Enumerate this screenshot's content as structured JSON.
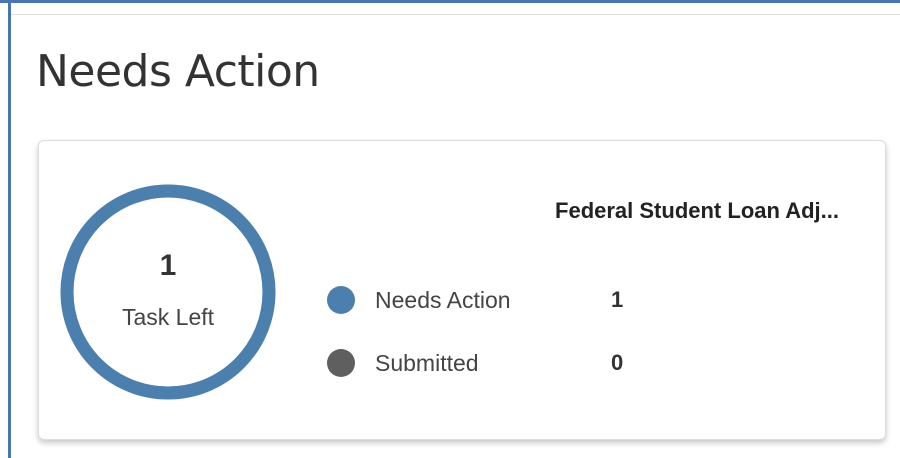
{
  "page": {
    "title": "Needs Action"
  },
  "card": {
    "title": "Federal Student Loan Adj...",
    "ring": {
      "count": "1",
      "label": "Task Left",
      "needs_action_fraction": 1.0
    },
    "legend": [
      {
        "label": "Needs Action",
        "value": "1",
        "color": "#4a7fae"
      },
      {
        "label": "Submitted",
        "value": "0",
        "color": "#5f5f5f"
      }
    ]
  },
  "colors": {
    "accent_border": "#4a74b8",
    "ring": "#4a7fae"
  }
}
